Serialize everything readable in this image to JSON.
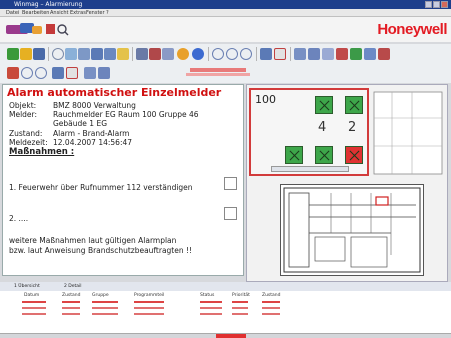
{
  "window": {
    "title": "Winmag – Alarmierung"
  },
  "menu": [
    "Datei",
    "Bearbeiten",
    "Ansicht",
    "Extras",
    "Fenster",
    "?"
  ],
  "brand": {
    "name": "Honeywell",
    "color": "#e31b23"
  },
  "alarm": {
    "title": "Alarm automatischer Einzelmelder",
    "fields": [
      {
        "label": "Objekt:",
        "value": "BMZ 8000 Verwaltung"
      },
      {
        "label": "Melder:",
        "value": "Rauchmelder EG Raum 100 Gruppe 46"
      },
      {
        "label": "",
        "value": "Gebäude 1 EG"
      },
      {
        "label": "Zustand:",
        "value": "Alarm - Brand-Alarm"
      },
      {
        "label": "Meldezeit:",
        "value": "12.04.2007 14:56:47"
      }
    ],
    "measures_heading": "Maßnahmen :",
    "step1": "1. Feuerwehr über Rufnummer 112 verständigen",
    "step2": "2. ....",
    "note_line1": "weitere Maßnahmen laut gültigen Alarmplan",
    "note_line2": "bzw. laut Anweisung  Brandschutzbeauftragten !!"
  },
  "panel": {
    "room": "100",
    "count_a": "4",
    "count_b": "2"
  },
  "bottom": {
    "tabs": [
      "1 Übersicht",
      "2 Detail"
    ],
    "columns": [
      "Datum",
      "Zustand",
      "Gruppe",
      "Programmteil",
      "Status",
      "Priorität",
      "Zustand"
    ]
  },
  "colors": {
    "alarm_red": "#d01010",
    "zone_green": "#3da64a",
    "zone_red": "#e03232"
  }
}
